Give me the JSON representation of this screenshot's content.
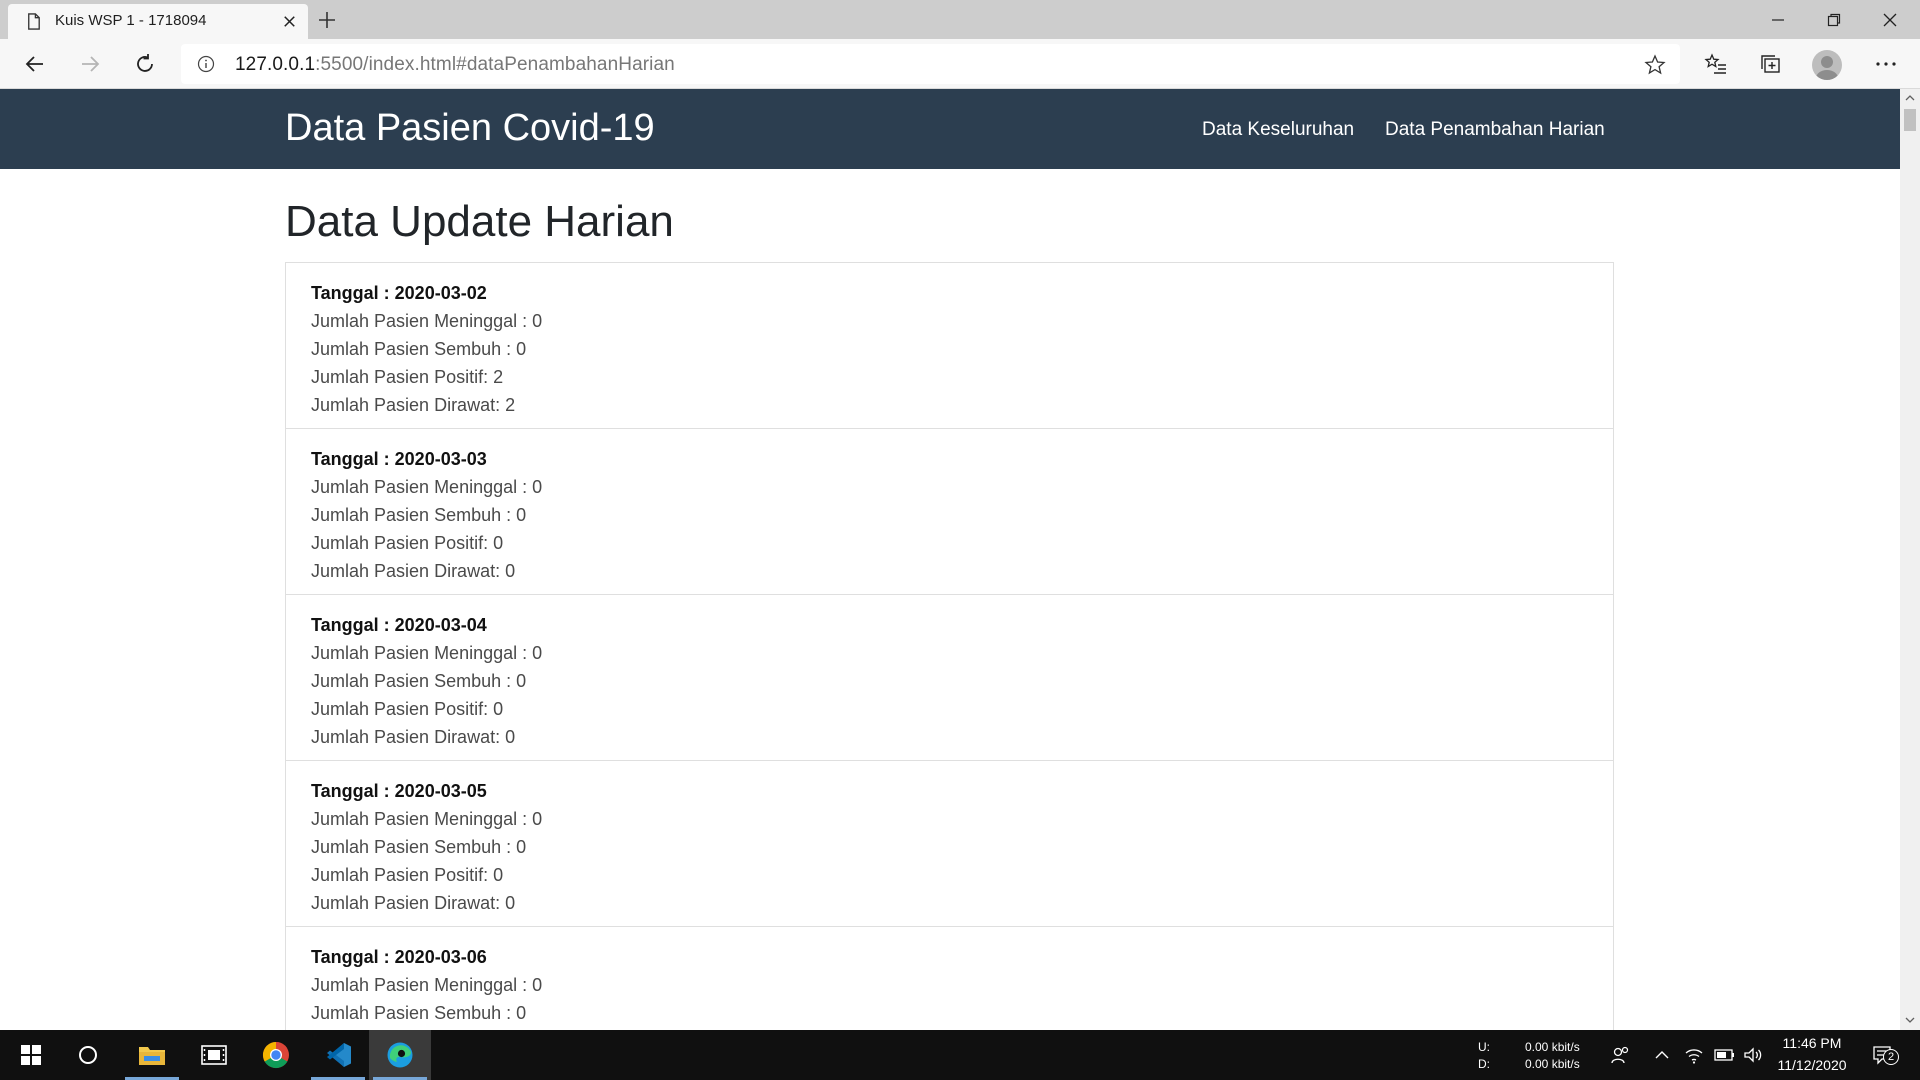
{
  "browser": {
    "tab_title": "Kuis WSP 1 - 1718094",
    "url_host": "127.0.0.1",
    "url_rest": ":5500/index.html#dataPenambahanHarian"
  },
  "navbar": {
    "brand": "Data Pasien Covid-19",
    "links": [
      "Data Keseluruhan",
      "Data Penambahan Harian"
    ],
    "background": "#2c3e50"
  },
  "page": {
    "title": "Data Update Harian"
  },
  "daily_updates": [
    {
      "date_label": "Tanggal : 2020-03-02",
      "meninggal": "Jumlah Pasien Meninggal : 0",
      "sembuh": "Jumlah Pasien Sembuh : 0",
      "positif": "Jumlah Pasien Positif: 2",
      "dirawat": "Jumlah Pasien Dirawat: 2"
    },
    {
      "date_label": "Tanggal : 2020-03-03",
      "meninggal": "Jumlah Pasien Meninggal : 0",
      "sembuh": "Jumlah Pasien Sembuh : 0",
      "positif": "Jumlah Pasien Positif: 0",
      "dirawat": "Jumlah Pasien Dirawat: 0"
    },
    {
      "date_label": "Tanggal : 2020-03-04",
      "meninggal": "Jumlah Pasien Meninggal : 0",
      "sembuh": "Jumlah Pasien Sembuh : 0",
      "positif": "Jumlah Pasien Positif: 0",
      "dirawat": "Jumlah Pasien Dirawat: 0"
    },
    {
      "date_label": "Tanggal : 2020-03-05",
      "meninggal": "Jumlah Pasien Meninggal : 0",
      "sembuh": "Jumlah Pasien Sembuh : 0",
      "positif": "Jumlah Pasien Positif: 0",
      "dirawat": "Jumlah Pasien Dirawat: 0"
    },
    {
      "date_label": "Tanggal : 2020-03-06",
      "meninggal": "Jumlah Pasien Meninggal : 0",
      "sembuh": "Jumlah Pasien Sembuh : 0",
      "positif": "",
      "dirawat": ""
    }
  ],
  "taskbar": {
    "net_up_label": "U:",
    "net_down_label": "D:",
    "net_up_value": "0.00 kbit/s",
    "net_down_value": "0.00 kbit/s",
    "time": "11:46 PM",
    "date": "11/12/2020",
    "notification_count": "2"
  }
}
